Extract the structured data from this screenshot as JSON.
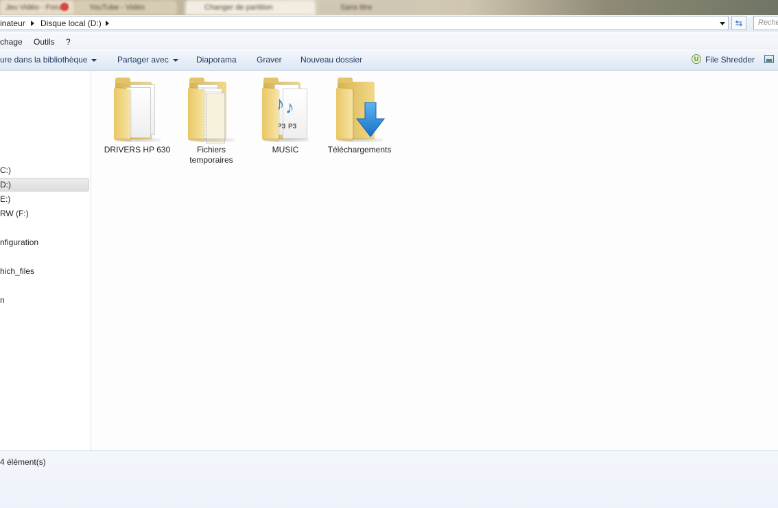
{
  "browser_tabs": {
    "items": [
      {
        "label": "Jeu Vidéo - Forum"
      },
      {
        "label": "YouTube - Vidéo"
      },
      {
        "label": "Changer de partition"
      },
      {
        "label": "Sans titre"
      }
    ]
  },
  "address_bar": {
    "crumbs": [
      "inateur",
      "Disque local (D:)"
    ],
    "search_placeholder": "Reche"
  },
  "menu": {
    "items": [
      "chage",
      "Outils",
      "?"
    ]
  },
  "toolbar": {
    "library_label": "ure dans la bibliothèque",
    "share_label": "Partager avec",
    "slideshow_label": "Diaporama",
    "burn_label": "Graver",
    "new_folder_label": "Nouveau dossier",
    "file_shredder_label": "File Shredder"
  },
  "nav_pane": {
    "items": [
      "C:)",
      "D:)",
      "E:)",
      "RW (F:)",
      "nfiguration",
      "hich_files",
      "n"
    ]
  },
  "content": {
    "items": [
      {
        "name": "DRIVERS HP 630",
        "icon": "folder-icon"
      },
      {
        "name": "Fichiers temporaires",
        "icon": "folder-icon"
      },
      {
        "name": "MUSIC",
        "icon": "music-folder-icon"
      },
      {
        "name": "Téléchargements",
        "icon": "downloads-folder-icon"
      }
    ]
  },
  "status": {
    "count_text": "4 élément(s)"
  },
  "colors": {
    "accent": "#2b6fc2",
    "folder": "#e9c766",
    "download_arrow": "#2a8fe0"
  }
}
